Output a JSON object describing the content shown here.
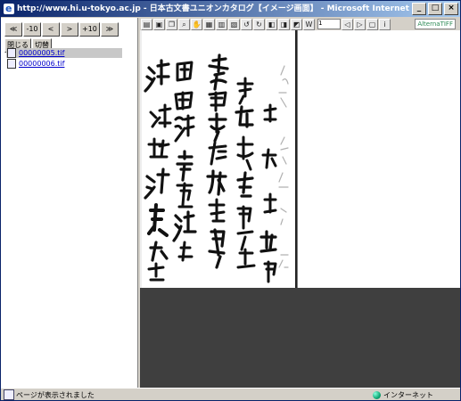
{
  "window": {
    "title": "http://www.hi.u-tokyo.ac.jp - 日本古文書ユニオンカタログ【イメージ画面】 - Microsoft Internet Explorer",
    "minimize": "_",
    "maximize": "□",
    "close": "×"
  },
  "nav": {
    "first": "≪",
    "minus10": "-10",
    "prev": "<",
    "next": ">",
    "plus10": "+10",
    "last": "≫",
    "close": "閉じる",
    "switch": "切替"
  },
  "files": [
    {
      "name": "00000005.tif",
      "selected": true
    },
    {
      "name": "00000006.tif",
      "selected": false
    }
  ],
  "toolbar": {
    "icons": [
      "printer-icon",
      "save-icon",
      "copy-icon",
      "zoom-icon",
      "hand-icon",
      "fit-page-icon",
      "fit-width-icon",
      "fit-height-icon",
      "rotate-left-icon",
      "rotate-right-icon",
      "flip-icon",
      "mirror-icon",
      "invert-icon",
      "w-icon"
    ],
    "page_select": "1",
    "brand": "AlternaTIFF"
  },
  "status": {
    "text": "ページが表示されました",
    "zone": "インターネット"
  },
  "colors": {
    "titlebar_start": "#0a246a",
    "titlebar_end": "#a6caf0",
    "viewer_bg": "#3f3f3f"
  }
}
